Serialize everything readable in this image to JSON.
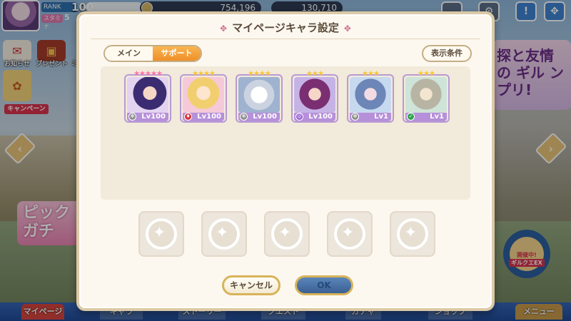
{
  "hud": {
    "rank_label": "RANK",
    "rank_value": "100",
    "stamina_label": "スタミナ",
    "stamina_value": "5",
    "mana": "754,196",
    "gems": "130,710"
  },
  "side_menu": {
    "mail": "お知らせ",
    "present": "プレゼント",
    "mission": "ミ",
    "campaign": "キャンペーン"
  },
  "banners": {
    "pickup": "ピック ガチ",
    "right": "探と友情の ギル ンプリ!",
    "guild_ex_top": "開催中!",
    "guild_ex": "ギルクエEX"
  },
  "nav": {
    "mypage": "マイページ",
    "items": [
      "キャラ",
      "ストーリー",
      "クエスト",
      "ガチャ",
      "ショップ"
    ],
    "menu": "メニュー"
  },
  "modal": {
    "title": "マイページキャラ設定",
    "tabs": [
      {
        "label": "メイン"
      },
      {
        "label": "サポート"
      }
    ],
    "filter_label": "表示条件",
    "cancel_label": "キャンセル",
    "ok_label": "OK"
  },
  "characters": [
    {
      "stars": 5,
      "level": "Lv100",
      "element": "gear-icon",
      "star_color": "#ff6fa6"
    },
    {
      "stars": 4,
      "level": "Lv100",
      "element": "fire-icon",
      "star_color": "#f7c531"
    },
    {
      "stars": 4,
      "level": "Lv100",
      "element": "gear-icon",
      "star_color": "#f7c531"
    },
    {
      "stars": 3,
      "level": "Lv100",
      "element": "swirl-icon",
      "star_color": "#f7c531"
    },
    {
      "stars": 3,
      "level": "Lv1",
      "element": "gear-icon",
      "star_color": "#f7c531"
    },
    {
      "stars": 3,
      "level": "Lv1",
      "element": "wind-icon",
      "star_color": "#f7c531"
    }
  ],
  "empty_slots": 5
}
